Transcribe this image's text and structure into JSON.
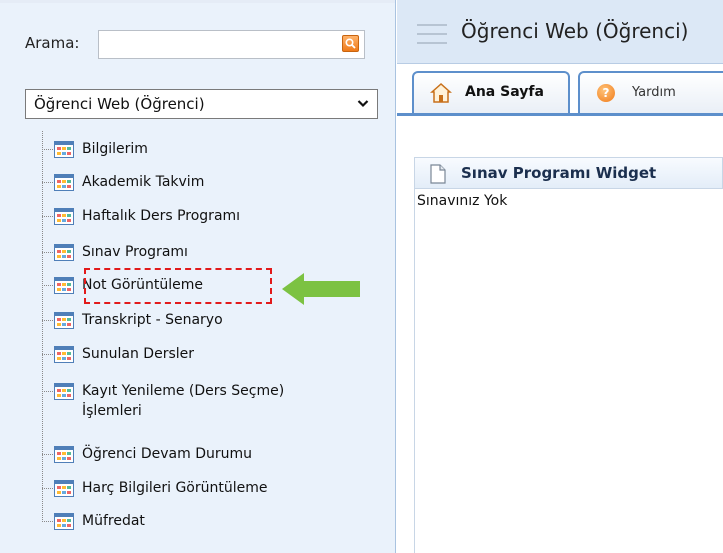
{
  "sidebar": {
    "search_label": "Arama:",
    "search_value": "",
    "module_select": "Öğrenci Web (Öğrenci)",
    "items": [
      {
        "label": "Bilgilerim"
      },
      {
        "label": "Akademik Takvim"
      },
      {
        "label": "Haftalık Ders Programı"
      },
      {
        "label": "Sınav Programı"
      },
      {
        "label": "Not Görüntüleme"
      },
      {
        "label": "Transkript - Senaryo"
      },
      {
        "label": "Sunulan Dersler"
      },
      {
        "label": "Kayıt Yenileme (Ders Seçme)",
        "label2": "İşlemleri"
      },
      {
        "label": "Öğrenci Devam Durumu"
      },
      {
        "label": "Harç Bilgileri Görüntüleme"
      },
      {
        "label": "Müfredat"
      }
    ]
  },
  "header": {
    "title": "Öğrenci Web (Öğrenci)"
  },
  "tabs": [
    {
      "label": "Ana Sayfa",
      "icon": "home-icon"
    },
    {
      "label": "Yardım",
      "icon": "help-icon"
    }
  ],
  "widget": {
    "title": "Sınav Programı Widget",
    "message": "Sınavınız Yok"
  },
  "colors": {
    "accent": "#5d8fcb",
    "highlight": "#e21b1b",
    "arrow": "#7cc242"
  }
}
